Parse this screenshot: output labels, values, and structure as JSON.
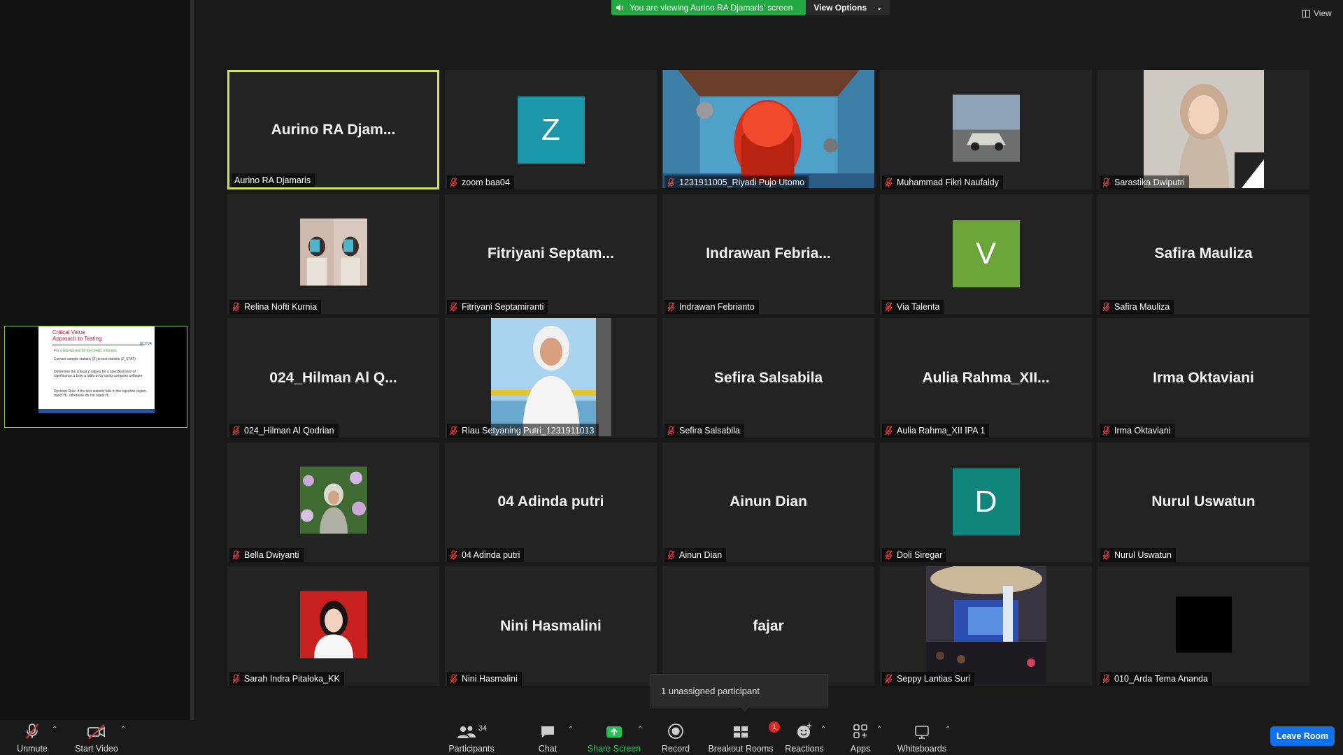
{
  "banner": {
    "text": "You are viewing Aurino RA Djamaris' screen",
    "color": "#23a942"
  },
  "view_options": {
    "label": "View Options"
  },
  "view_button": {
    "label": "View"
  },
  "shared_slide": {
    "title_line1": "Critical Value",
    "title_line2": "Approach to Testing",
    "logo": "DCOVA",
    "bullets": [
      "For a two-tail test for the mean, σ known:",
      "Convert sample statistic (X̄) to test statistic (Z_STAT)",
      "Determine the critical Z values for a specified level of significance α from a table or by using computer software",
      "Decision Rule: If the test statistic falls in the rejection region, reject H₀; otherwise do not reject H₀"
    ]
  },
  "participants": [
    {
      "big_name": "Aurino  RA  Djam...",
      "label": "Aurino RA Djamaris",
      "type": "name",
      "active": true,
      "muted": false
    },
    {
      "avatar_letter": "Z",
      "avatar_color": "#1a96a8",
      "label": "zoom baa04",
      "type": "avatar",
      "muted": true
    },
    {
      "label": "1231911005_Riyadi Pujo Utomo",
      "type": "photo",
      "photo": "spongebob-room",
      "muted": true
    },
    {
      "label": "Muhammad Fikri Naufaldy",
      "type": "photo",
      "photo": "car",
      "muted": true
    },
    {
      "label": "Sarastika Dwiputri",
      "type": "photo",
      "photo": "woman-hijab",
      "muted": true
    },
    {
      "label": "Relina Nofti Kurnia",
      "type": "photo",
      "photo": "mirror-selfie",
      "muted": true
    },
    {
      "big_name": "Fitriyani  Septam...",
      "label": "Fitriyani Septamiranti",
      "type": "name",
      "muted": true
    },
    {
      "big_name": "Indrawan  Febria...",
      "label": "Indrawan Febrianto",
      "type": "name",
      "muted": true
    },
    {
      "avatar_letter": "V",
      "avatar_color": "#6ba53a",
      "label": "Via Talenta",
      "type": "avatar",
      "muted": true
    },
    {
      "big_name": "Safira Mauliza",
      "label": "Safira Mauliza",
      "type": "name",
      "muted": true
    },
    {
      "big_name": "024_Hilman Al Q...",
      "label": "024_Hilman Al Qodrian",
      "type": "name",
      "muted": true
    },
    {
      "label": "Riau Setyaning Putri_1231911013",
      "type": "photo",
      "photo": "woman-white",
      "muted": true
    },
    {
      "big_name": "Sefira Salsabila",
      "label": "Sefira Salsabila",
      "type": "name",
      "muted": true
    },
    {
      "big_name": "Aulia  Rahma_XII...",
      "label": "Aulia Rahma_XII IPA 1",
      "type": "name",
      "muted": true
    },
    {
      "big_name": "Irma Oktaviani",
      "label": "Irma Oktaviani",
      "type": "name",
      "muted": true
    },
    {
      "label": "Bella Dwiyanti",
      "type": "photo",
      "photo": "flowers",
      "muted": true
    },
    {
      "big_name": "04 Adinda putri",
      "label": "04 Adinda putri",
      "type": "name",
      "muted": true
    },
    {
      "big_name": "Ainun Dian",
      "label": "Ainun Dian",
      "type": "name",
      "muted": true
    },
    {
      "avatar_letter": "D",
      "avatar_color": "#10857c",
      "label": "Doli Siregar",
      "type": "avatar",
      "muted": true
    },
    {
      "big_name": "Nurul Uswatun",
      "label": "Nurul Uswatun",
      "type": "name",
      "muted": true
    },
    {
      "label": "Sarah Indra Pitaloka_KK",
      "type": "photo",
      "photo": "red-portrait",
      "muted": true
    },
    {
      "big_name": "Nini Hasmalini",
      "label": "Nini Hasmalini",
      "type": "name",
      "muted": true
    },
    {
      "big_name": "fajar",
      "label": "",
      "type": "name",
      "muted": true
    },
    {
      "label": "Seppy Lantias Suri",
      "type": "photo",
      "photo": "event-hall",
      "muted": true
    },
    {
      "label": "010_Arda Tema Ananda",
      "type": "photo",
      "photo": "black",
      "muted": true
    }
  ],
  "tooltip": {
    "text": "1 unassigned participant"
  },
  "toolbar": {
    "unmute": "Unmute",
    "start_video": "Start Video",
    "participants": "Participants",
    "participants_count": "34",
    "chat": "Chat",
    "share_screen": "Share Screen",
    "record": "Record",
    "breakout_rooms": "Breakout Rooms",
    "breakout_badge": "1",
    "reactions": "Reactions",
    "apps": "Apps",
    "whiteboards": "Whiteboards",
    "leave_room": "Leave Room"
  }
}
